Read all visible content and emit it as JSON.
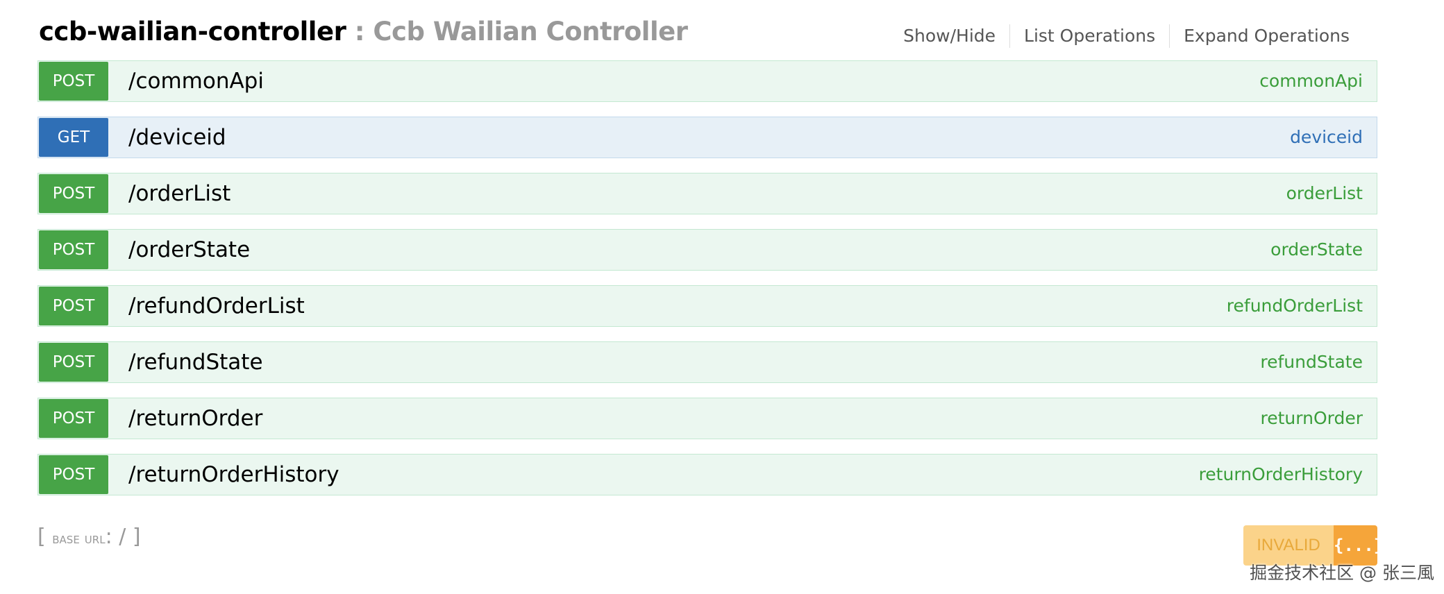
{
  "resource": {
    "name": "ccb-wailian-controller",
    "separator": " : ",
    "description": "Ccb Wailian Controller"
  },
  "options": {
    "show_hide": "Show/Hide",
    "list_operations": "List Operations",
    "expand_operations": "Expand Operations"
  },
  "operations": [
    {
      "method": "POST",
      "path": "/commonApi",
      "nickname": "commonApi"
    },
    {
      "method": "GET",
      "path": "/deviceid",
      "nickname": "deviceid"
    },
    {
      "method": "POST",
      "path": "/orderList",
      "nickname": "orderList"
    },
    {
      "method": "POST",
      "path": "/orderState",
      "nickname": "orderState"
    },
    {
      "method": "POST",
      "path": "/refundOrderList",
      "nickname": "refundOrderList"
    },
    {
      "method": "POST",
      "path": "/refundState",
      "nickname": "refundState"
    },
    {
      "method": "POST",
      "path": "/returnOrder",
      "nickname": "returnOrder"
    },
    {
      "method": "POST",
      "path": "/returnOrderHistory",
      "nickname": "returnOrderHistory"
    }
  ],
  "footer": {
    "open_bracket": "[ ",
    "base_url_label": "base url",
    "colon_value": ": / ",
    "close_bracket": "]"
  },
  "validator": {
    "status": "INVALID",
    "icon": "{...}"
  },
  "watermark": "掘金技术社区 @ 张三風",
  "colors": {
    "post": "#47a447",
    "post_bg": "#ebf7f0",
    "get": "#2f6fb6",
    "get_bg": "#e7f0f7",
    "validator_text_bg": "#fbd38a",
    "validator_icon_bg": "#f5a53a"
  }
}
